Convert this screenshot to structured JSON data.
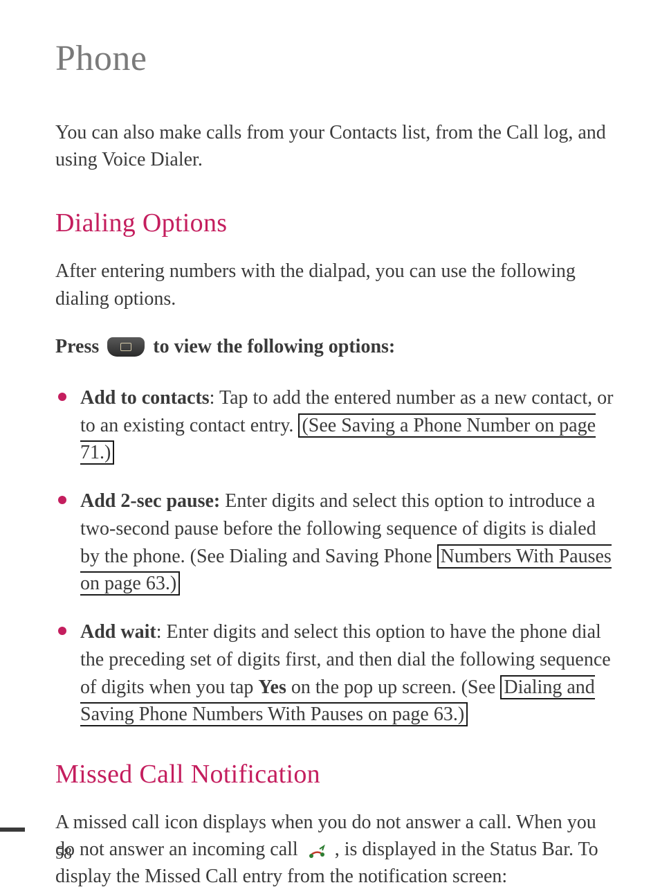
{
  "title": "Phone",
  "intro": "You can also make calls from your Contacts list, from the Call log, and using Voice Dialer.",
  "sections": {
    "dialing_options": {
      "heading": "Dialing Options",
      "intro": "After entering numbers with the dialpad, you can use the following dialing options.",
      "press_before": "Press",
      "press_after": "to view the following options:",
      "items": {
        "add_contacts": {
          "term": "Add to contacts",
          "text_before": ": Tap to add the entered number as a new contact, or to an existing contact entry. ",
          "link": "(See Saving a Phone Number on page 71.)"
        },
        "add_pause": {
          "term": "Add 2-sec pause:",
          "text_before": " Enter digits and select this option to introduce a two-second pause before the following sequence of digits is dialed by the phone. (See Dialing and Saving Phone ",
          "link": "Numbers With Pauses on page 63.)"
        },
        "add_wait": {
          "term": "Add wait",
          "text_before": ": Enter digits and select this option to have the phone dial the preceding set of digits first, and then dial the following sequence of digits when you tap ",
          "yes": "Yes",
          "text_after_yes": " on the pop up screen. (See ",
          "link": "Dialing and Saving Phone Numbers With Pauses on page 63.)"
        }
      }
    },
    "missed_call": {
      "heading": "Missed Call Notification",
      "text_before": "A missed call icon displays when you do not answer a call. When you do not answer an incoming call ",
      "text_after": ", is displayed in the Status Bar. To display the Missed Call entry from the notification screen:"
    }
  },
  "page_number": "58",
  "icons": {
    "menu": "menu-button-icon",
    "missed_call": "missed-call-icon"
  }
}
